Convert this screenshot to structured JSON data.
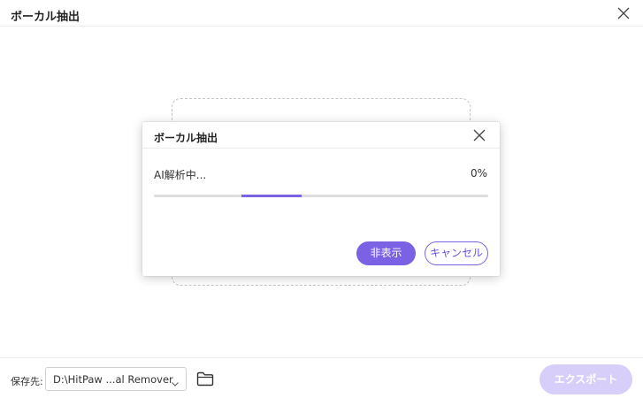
{
  "window": {
    "title": "ボーカル抽出"
  },
  "dialog": {
    "title": "ボーカル抽出",
    "status": "AI解析中...",
    "percent": "0%",
    "progress": 0,
    "hide_label": "非表示",
    "cancel_label": "キャンセル"
  },
  "footer": {
    "save_label": "保存先:",
    "path_value": "D:\\HitPaw ...al Remover",
    "export_label": "エクスポート",
    "export_enabled": false
  },
  "icons": {
    "window_close": "close-icon",
    "dialog_close": "close-icon",
    "dropdown": "chevron-down-icon",
    "folder": "folder-icon"
  },
  "colors": {
    "accent": "#7b61e4",
    "accent_disabled": "#d7cff9",
    "track": "#dddddd"
  }
}
